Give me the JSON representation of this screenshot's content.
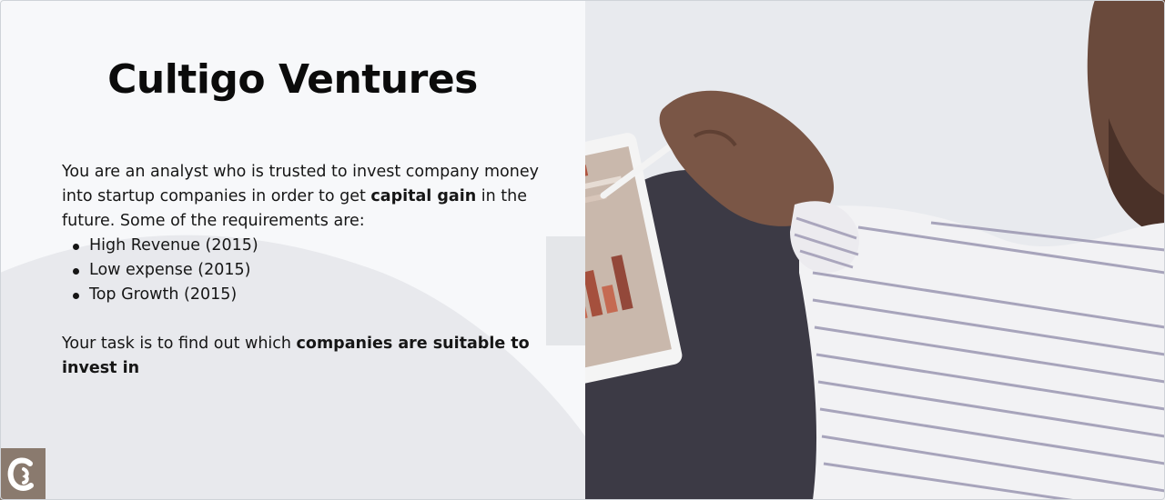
{
  "slide": {
    "title": "Cultigo Ventures",
    "intro_part1": "You are an analyst who is trusted to invest company money into startup companies in order to get ",
    "intro_bold": "capital gain",
    "intro_part2": " in the future. Some of the requirements are:",
    "requirements": [
      "High Revenue (2015)",
      "Low expense (2015)",
      "Top Growth (2015)"
    ],
    "task_part1": "Your task is to find out which ",
    "task_bold": "companies are suitable to invest in"
  },
  "icons": {
    "logo": "cultigo-logo-icon",
    "bullet": "bullet-dot-icon"
  },
  "colors": {
    "logo_background": "#8a7a6e",
    "title_text": "#0b0b0b",
    "body_text": "#161616",
    "panel_background": "#f7f8fa"
  }
}
